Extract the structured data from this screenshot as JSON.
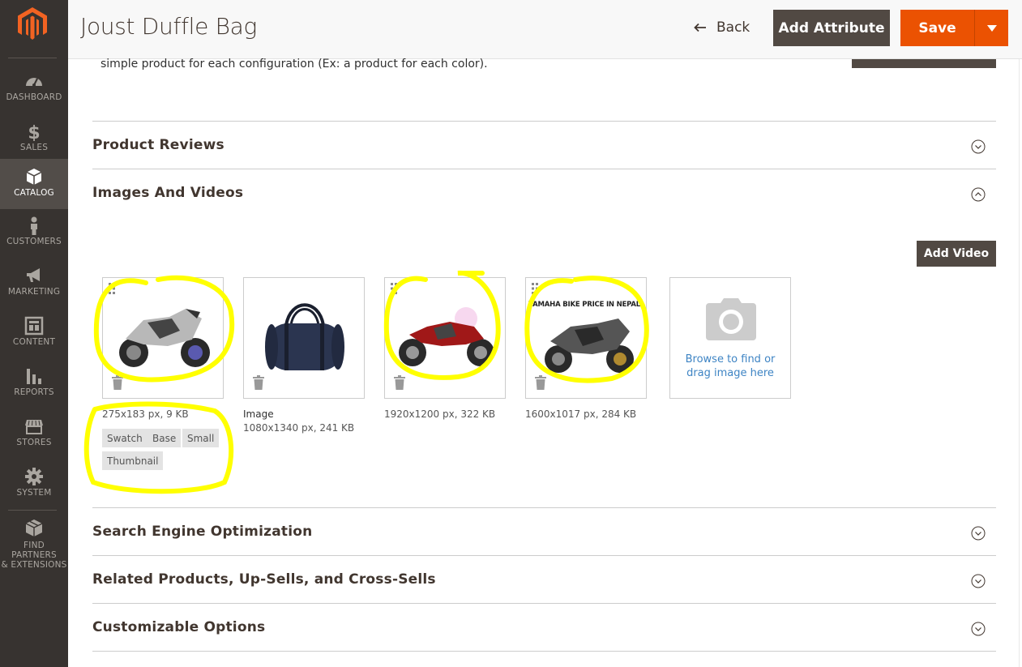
{
  "header": {
    "title": "Joust Duffle Bag",
    "back_label": "Back",
    "add_attribute_label": "Add Attribute",
    "save_label": "Save"
  },
  "sidebar": {
    "items": [
      {
        "label": "DASHBOARD",
        "icon": "dashboard-icon"
      },
      {
        "label": "SALES",
        "icon": "dollar-icon"
      },
      {
        "label": "CATALOG",
        "icon": "box-icon",
        "active": true
      },
      {
        "label": "CUSTOMERS",
        "icon": "person-icon"
      },
      {
        "label": "MARKETING",
        "icon": "megaphone-icon"
      },
      {
        "label": "CONTENT",
        "icon": "layout-icon"
      },
      {
        "label": "REPORTS",
        "icon": "bar-chart-icon"
      },
      {
        "label": "STORES",
        "icon": "store-icon"
      },
      {
        "label": "SYSTEM",
        "icon": "gear-icon"
      },
      {
        "label_line1": "FIND PARTNERS",
        "label_line2": "& EXTENSIONS",
        "icon": "extensions-icon"
      }
    ]
  },
  "configurations": {
    "text": "simple product for each configuration (Ex: a product for each color)."
  },
  "sections": {
    "product_reviews": "Product Reviews",
    "images_and_videos": "Images And Videos",
    "seo": "Search Engine Optimization",
    "related": "Related Products, Up-Sells, and Cross-Sells",
    "custom_options": "Customizable Options"
  },
  "media": {
    "add_video_label": "Add Video",
    "images": [
      {
        "caption": "275x183 px, 9 KB",
        "roles": [
          "Swatch",
          "Base",
          "Small",
          "Thumbnail"
        ],
        "subject": "motorcycle-silver"
      },
      {
        "name": "Image",
        "caption": "1080x1340 px, 241 KB",
        "subject": "duffle-bag"
      },
      {
        "caption": "1920x1200 px, 322 KB",
        "subject": "motorcycle-red"
      },
      {
        "caption": "1600x1017 px, 284 KB",
        "subject": "motorcycle-black",
        "overlay_text": "YAMAHA BIKE PRICE IN NEPAL"
      }
    ],
    "upload_line1": "Browse to find or",
    "upload_line2": "drag image here"
  },
  "colors": {
    "sidebar_bg": "#373330",
    "primary_orange": "#eb5202",
    "dark_button": "#514943",
    "highlight_yellow": "#ffff00",
    "link_blue": "#3e84c4"
  }
}
